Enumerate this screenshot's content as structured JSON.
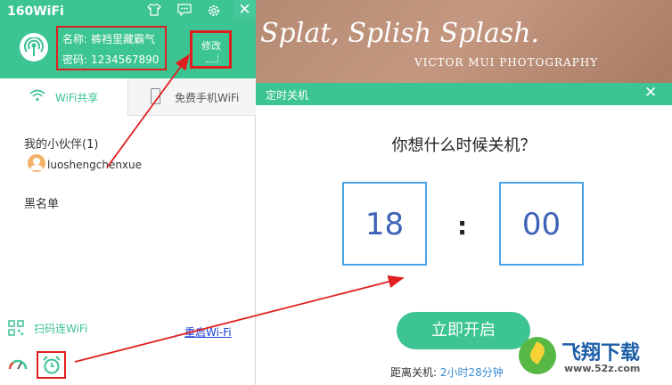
{
  "left_panel": {
    "title": "160WiFi",
    "header_icons": [
      "shirt-icon",
      "chat-icon",
      "gear-icon",
      "close-icon"
    ],
    "close_glyph": "✕",
    "wifi_info": {
      "name_label": "名称:",
      "name_value": "裤裆里藏霸气",
      "password_label": "密码:",
      "password_value": "1234567890"
    },
    "modify_label": "修改",
    "tabs": [
      {
        "label": "WiFi共享",
        "active": true
      },
      {
        "label": "免费手机WiFi",
        "active": false
      }
    ],
    "friends_title": "我的小伙伴(1)",
    "friends": [
      {
        "name": "luoshengchenxue"
      }
    ],
    "blacklist_title": "黑名单",
    "scan_label": "扫码连WiFi",
    "restart_link": "重启Wi-Fi"
  },
  "background": {
    "title": "Splat, Splish Splash.",
    "subtitle": "VICTOR MUI PHOTOGRAPHY"
  },
  "dialog": {
    "title": "定时关机",
    "close_glyph": "✕",
    "question": "你想什么时候关机？",
    "hour": "18",
    "separator": ":",
    "minute": "00",
    "start_button": "立即开启",
    "countdown_label": "距离关机:",
    "countdown_value": "2小时28分钟"
  },
  "watermark": {
    "name": "飞翔下载",
    "url": "www.52z.com"
  },
  "colors": {
    "accent_green": "#3cc492",
    "highlight_red": "#e02020",
    "time_blue": "#3d63b8",
    "link_blue": "#1a3fd6"
  }
}
